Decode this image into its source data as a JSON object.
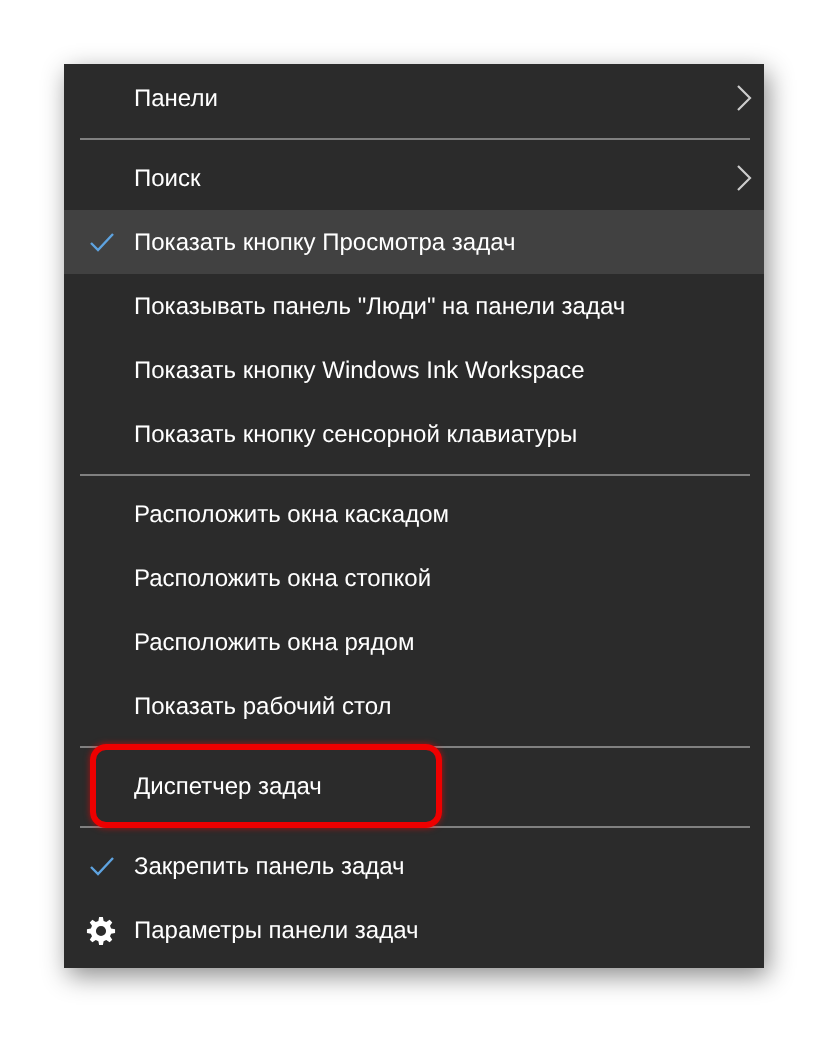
{
  "menu": {
    "groups": [
      {
        "items": [
          {
            "kind": "submenu",
            "label": "Панели",
            "selected": false,
            "annotated": false
          }
        ]
      },
      {
        "items": [
          {
            "kind": "submenu",
            "label": "Поиск",
            "selected": false,
            "annotated": false
          },
          {
            "kind": "check",
            "label": "Показать кнопку Просмотра задач",
            "checked": true,
            "selected": true,
            "annotated": false
          },
          {
            "kind": "check",
            "label": "Показывать панель \"Люди\" на панели задач",
            "checked": false,
            "selected": false,
            "annotated": false
          },
          {
            "kind": "check",
            "label": "Показать кнопку Windows Ink Workspace",
            "checked": false,
            "selected": false,
            "annotated": false
          },
          {
            "kind": "check",
            "label": "Показать кнопку сенсорной клавиатуры",
            "checked": false,
            "selected": false,
            "annotated": false
          }
        ]
      },
      {
        "items": [
          {
            "kind": "command",
            "label": "Расположить окна каскадом",
            "selected": false,
            "annotated": false
          },
          {
            "kind": "command",
            "label": "Расположить окна стопкой",
            "selected": false,
            "annotated": false
          },
          {
            "kind": "command",
            "label": "Расположить окна рядом",
            "selected": false,
            "annotated": false
          },
          {
            "kind": "command",
            "label": "Показать рабочий стол",
            "selected": false,
            "annotated": false
          }
        ]
      },
      {
        "items": [
          {
            "kind": "command",
            "label": "Диспетчер задач",
            "selected": false,
            "annotated": true
          }
        ]
      },
      {
        "items": [
          {
            "kind": "check",
            "label": "Закрепить панель задач",
            "checked": true,
            "selected": false,
            "annotated": false
          },
          {
            "kind": "settings",
            "label": "Параметры панели задач",
            "selected": false,
            "annotated": false
          }
        ]
      }
    ]
  }
}
